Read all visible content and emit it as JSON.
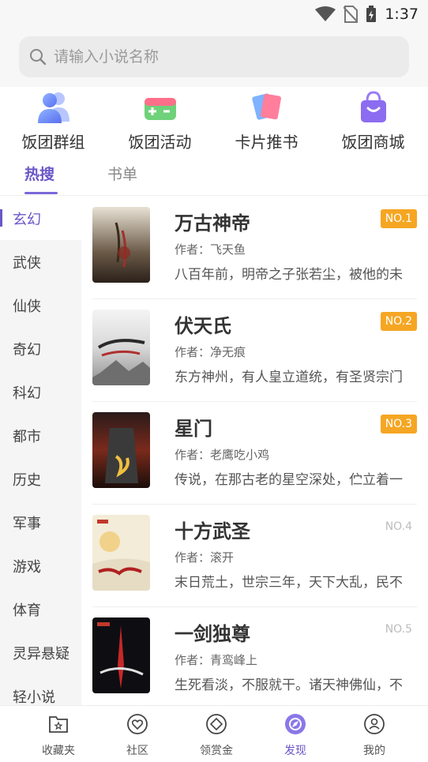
{
  "status_bar": {
    "time": "1:37"
  },
  "search": {
    "placeholder": "请输入小说名称"
  },
  "features": [
    {
      "label": "饭团群组",
      "icon": "group-icon"
    },
    {
      "label": "饭团活动",
      "icon": "gamepad-icon"
    },
    {
      "label": "卡片推书",
      "icon": "cards-icon"
    },
    {
      "label": "饭团商城",
      "icon": "shopping-bag-icon"
    }
  ],
  "tabs": [
    {
      "label": "热搜",
      "active": true
    },
    {
      "label": "书单",
      "active": false
    }
  ],
  "categories": [
    "玄幻",
    "武侠",
    "仙侠",
    "奇幻",
    "科幻",
    "都市",
    "历史",
    "军事",
    "游戏",
    "体育",
    "灵异悬疑",
    "轻小说"
  ],
  "active_category": "玄幻",
  "books": [
    {
      "title": "万古神帝",
      "author": "作者：飞天鱼",
      "desc": "八百年前，明帝之子张若尘，被他的未",
      "rank": "NO.1",
      "rank_highlight": true
    },
    {
      "title": "伏天氏",
      "author": "作者：净无痕",
      "desc": "东方神州，有人皇立道统，有圣贤宗门",
      "rank": "NO.2",
      "rank_highlight": true
    },
    {
      "title": "星门",
      "author": "作者：老鹰吃小鸡",
      "desc": "传说，在那古老的星空深处，伫立着一",
      "rank": "NO.3",
      "rank_highlight": true
    },
    {
      "title": "十方武圣",
      "author": "作者：滚开",
      "desc": "末日荒土，世宗三年，天下大乱，民不",
      "rank": "NO.4",
      "rank_highlight": false
    },
    {
      "title": "一剑独尊",
      "author": "作者：青鸾峰上",
      "desc": "生死看淡，不服就干。诸天神佛仙，不",
      "rank": "NO.5",
      "rank_highlight": false
    }
  ],
  "bottom_nav": [
    {
      "label": "收藏夹",
      "icon": "bookshelf-icon"
    },
    {
      "label": "社区",
      "icon": "community-heart-icon"
    },
    {
      "label": "领赏金",
      "icon": "reward-diamond-icon"
    },
    {
      "label": "发现",
      "icon": "discover-compass-icon",
      "active": true
    },
    {
      "label": "我的",
      "icon": "profile-icon"
    }
  ],
  "colors": {
    "accent": "#6b56c7",
    "rank_badge": "#f5a623"
  }
}
